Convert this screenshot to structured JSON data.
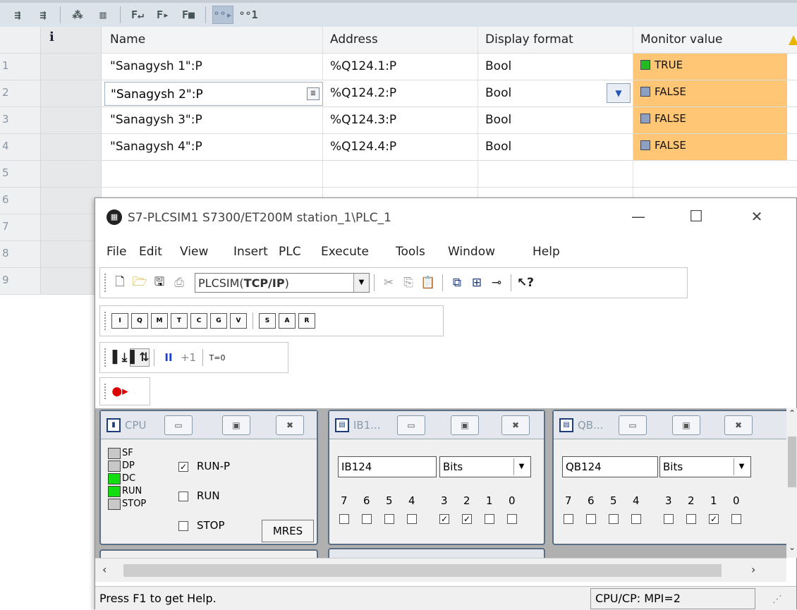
{
  "tia": {
    "toolbar_icons": [
      "insert-row-icon",
      "add-row-icon",
      "modify-values-icon",
      "monitor-once-icon",
      "force-icon",
      "force-start-icon",
      "force-stop-icon",
      "monitor-all-icon",
      "monitor-once-now-icon"
    ],
    "toolbar_glyphs": [
      "⇶",
      "⇶",
      "⁂",
      "▥",
      "F↵",
      "F▸",
      "F■",
      "ᵒᵒ▸",
      "ᵒᵒ1"
    ],
    "columns": {
      "info": "i",
      "name": "Name",
      "address": "Address",
      "display_format": "Display format",
      "monitor_value": "Monitor value"
    },
    "rows": [
      {
        "num": "1",
        "name": "\"Sanagysh 1\":P",
        "address": "%Q124.1:P",
        "format": "Bool",
        "value": "TRUE",
        "state": "on"
      },
      {
        "num": "2",
        "name": "\"Sanagysh 2\":P",
        "address": "%Q124.2:P",
        "format": "Bool",
        "value": "FALSE",
        "state": "off"
      },
      {
        "num": "3",
        "name": "\"Sanagysh 3\":P",
        "address": "%Q124.3:P",
        "format": "Bool",
        "value": "FALSE",
        "state": "off"
      },
      {
        "num": "4",
        "name": "\"Sanagysh 4\":P",
        "address": "%Q124.4:P",
        "format": "Bool",
        "value": "FALSE",
        "state": "off"
      },
      {
        "num": "5"
      },
      {
        "num": "6"
      },
      {
        "num": "7"
      },
      {
        "num": "8"
      },
      {
        "num": "9"
      }
    ],
    "colors": {
      "monitor_bg": "#ffc675",
      "true_led": "#22bb22",
      "false_led": "#8ea0c2"
    }
  },
  "plcsim": {
    "title": "S7-PLCSIM1    S7300/ET200M station_1\\PLC_1",
    "window_buttons": {
      "minimize": "—",
      "maximize": "☐",
      "close": "✕"
    },
    "menu": [
      "File",
      "Edit",
      "View",
      "Insert",
      "PLC",
      "Execute",
      "Tools",
      "Window",
      "Help"
    ],
    "connection_prefix": "PLCSIM(",
    "connection_bold": "TCP/IP",
    "connection_suffix": ")",
    "toolbar3": {
      "pause": "II",
      "step": "+1",
      "reset_timer": "T=0"
    },
    "cpu": {
      "title": "CPU",
      "leds": [
        {
          "label": "SF",
          "on": false
        },
        {
          "label": "DP",
          "on": false
        },
        {
          "label": "DC",
          "on": true
        },
        {
          "label": "RUN",
          "on": true
        },
        {
          "label": "STOP",
          "on": false
        }
      ],
      "modes": [
        {
          "label": "RUN-P",
          "checked": true
        },
        {
          "label": "RUN",
          "checked": false
        },
        {
          "label": "STOP",
          "checked": false
        }
      ],
      "mres": "MRES"
    },
    "ib": {
      "title": "IB1...",
      "address": "IB124",
      "format": "Bits",
      "bit_labels": [
        "7",
        "6",
        "5",
        "4",
        "3",
        "2",
        "1",
        "0"
      ],
      "bits": [
        false,
        false,
        false,
        false,
        true,
        true,
        false,
        false
      ]
    },
    "qb": {
      "title": "QB...",
      "address": "QB124",
      "format": "Bits",
      "bit_labels": [
        "7",
        "6",
        "5",
        "4",
        "3",
        "2",
        "1",
        "0"
      ],
      "bits": [
        false,
        false,
        false,
        false,
        false,
        false,
        true,
        false
      ]
    },
    "status_left": "Press F1 to get Help.",
    "status_right": "CPU/CP:  MPI=2"
  }
}
